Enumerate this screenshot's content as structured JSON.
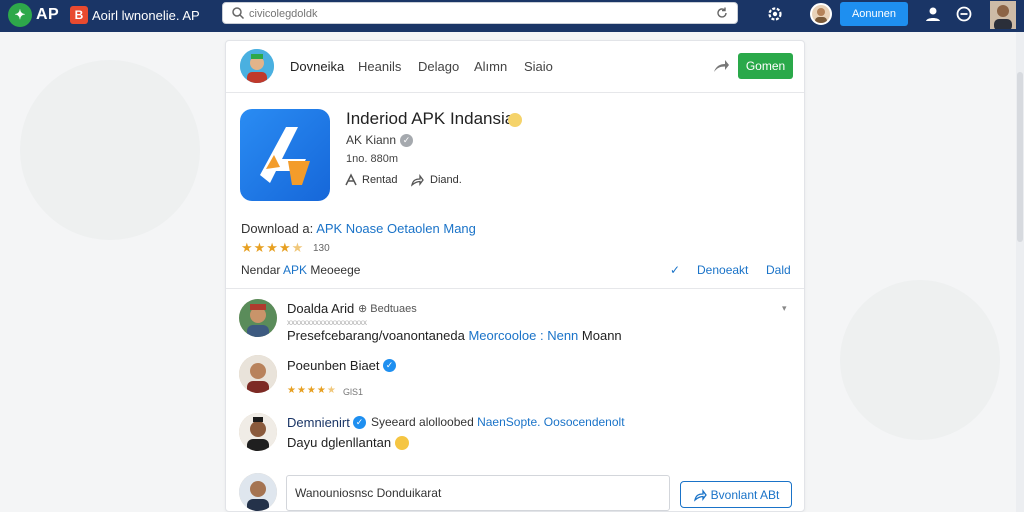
{
  "topbar": {
    "logo_text": "AP",
    "logo_badge": "B",
    "site_title": "Aoirl lwnonelie. AP",
    "search_placeholder": "civicolegdoldk",
    "primary_button": "Aonunen",
    "colors": {
      "bar": "#1a3566",
      "button": "#1e8ff0"
    }
  },
  "card": {
    "tabs": [
      "Dovneika",
      "Heanils",
      "Delago",
      "Alımn",
      "Siaio"
    ],
    "green_button": "Gomen",
    "app": {
      "title": "Inderiod APK Indansia",
      "developer": "AK Kiann",
      "size": "1no. 880m",
      "actions": [
        "Rentad",
        "Diand."
      ]
    },
    "download_prefix": "Download a:",
    "download_link": "APK Noase Oetaolen Mang",
    "rating": "130",
    "rating_stars": 4.5,
    "row3_prefix": "Nendar",
    "row3_link": "APK",
    "row3_text": "Meoeege",
    "row3_right_links": [
      "Denoeakt",
      "Dald"
    ],
    "comments": [
      {
        "name": "Doalda Arid",
        "meta": "Bedtuaes",
        "sub": "xxxxxxxxxxxxxxxxxxxx",
        "text_prefix": "Presefcebarang/voanontaneda",
        "text_link": "Meorcooloe : Nenn",
        "text_suffix": "Moann"
      },
      {
        "name": "Poeunben Biaet",
        "stars": 4,
        "count": "GlS1"
      },
      {
        "name": "Demnienirt",
        "meta": "Syeeard alolloobed",
        "meta_link": "NaenSopte. Oosocendenolt",
        "text": "Dayu dglenllantan"
      }
    ],
    "reply_value": "Wanouniosnsc Donduikarat",
    "reply_button": "Bvonlant ABt"
  }
}
